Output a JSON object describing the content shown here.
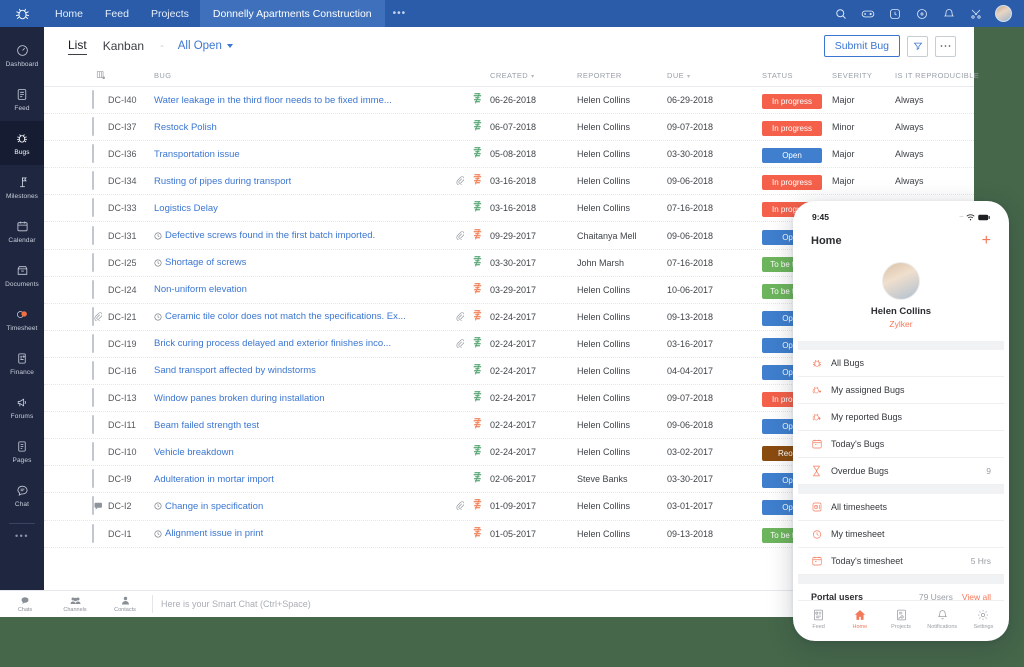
{
  "topbar": {
    "logo_icon": "bug-logo-icon",
    "nav": [
      {
        "label": "Home",
        "active": false
      },
      {
        "label": "Feed",
        "active": false
      },
      {
        "label": "Projects",
        "active": false
      },
      {
        "label": "Donnelly Apartments Construction",
        "active": true
      }
    ],
    "more_dots": "•••",
    "icons": [
      "search-icon",
      "game-controller-icon",
      "clock-icon",
      "plus-circle-icon",
      "bell-icon",
      "tools-icon"
    ],
    "avatar": "user-avatar"
  },
  "sidebar": {
    "items": [
      {
        "label": "Dashboard",
        "icon": "dashboard-icon",
        "active": false
      },
      {
        "label": "Feed",
        "icon": "feed-icon",
        "active": false
      },
      {
        "label": "Bugs",
        "icon": "bug-icon",
        "active": true
      },
      {
        "label": "Milestones",
        "icon": "milestone-flag-icon",
        "active": false
      },
      {
        "label": "Calendar",
        "icon": "calendar-icon",
        "active": false
      },
      {
        "label": "Documents",
        "icon": "documents-icon",
        "active": false
      },
      {
        "label": "Timesheet",
        "icon": "timesheet-icon",
        "active": false
      },
      {
        "label": "Finance",
        "icon": "finance-icon",
        "active": false
      },
      {
        "label": "Forums",
        "icon": "megaphone-icon",
        "active": false
      },
      {
        "label": "Pages",
        "icon": "pages-icon",
        "active": false
      },
      {
        "label": "Chat",
        "icon": "chat-icon",
        "active": false
      }
    ],
    "more_dots": "•••"
  },
  "toolbar": {
    "tab_list": "List",
    "tab_kanban": "Kanban",
    "separator": "-",
    "filter_label": "All Open",
    "submit_label": "Submit Bug",
    "filter_icon": "funnel-icon",
    "more_icon": "ellipsis-icon"
  },
  "table": {
    "headers": {
      "bug": "BUG",
      "created": "CREATED",
      "reporter": "REPORTER",
      "due": "DUE",
      "status": "STATUS",
      "severity": "SEVERITY",
      "reproducible": "IS IT REPRODUCIBLE"
    },
    "status_colors": {
      "In progress": "#f4604a",
      "Open": "#3f7fce",
      "To be tested": "#6db55d",
      "Reopen": "#8a4b0f"
    },
    "rows": [
      {
        "lead": "",
        "id": "DC-I40",
        "clock": false,
        "title": "Water leakage in the third floor needs to be fixed imme...",
        "attach": false,
        "priority": "green",
        "created": "06-26-2018",
        "reporter": "Helen Collins",
        "due": "06-29-2018",
        "status": "In progress",
        "severity": "Major",
        "reproducible": "Always"
      },
      {
        "lead": "",
        "id": "DC-I37",
        "clock": false,
        "title": "Restock Polish",
        "attach": false,
        "priority": "green",
        "created": "06-07-2018",
        "reporter": "Helen Collins",
        "due": "09-07-2018",
        "status": "In progress",
        "severity": "Minor",
        "reproducible": "Always"
      },
      {
        "lead": "",
        "id": "DC-I36",
        "clock": false,
        "title": "Transportation issue",
        "attach": false,
        "priority": "green",
        "created": "05-08-2018",
        "reporter": "Helen Collins",
        "due": "03-30-2018",
        "status": "Open",
        "severity": "Major",
        "reproducible": "Always"
      },
      {
        "lead": "",
        "id": "DC-I34",
        "clock": false,
        "title": "Rusting of pipes during transport",
        "attach": true,
        "priority": "orange",
        "created": "03-16-2018",
        "reporter": "Helen Collins",
        "due": "09-06-2018",
        "status": "In progress",
        "severity": "Major",
        "reproducible": "Always"
      },
      {
        "lead": "",
        "id": "DC-I33",
        "clock": false,
        "title": "Logistics Delay",
        "attach": false,
        "priority": "green",
        "created": "03-16-2018",
        "reporter": "Helen Collins",
        "due": "07-16-2018",
        "status": "In progress",
        "severity": "",
        "reproducible": ""
      },
      {
        "lead": "",
        "id": "DC-I31",
        "clock": true,
        "title": "Defective screws found in the first batch imported.",
        "attach": true,
        "priority": "orange",
        "created": "09-29-2017",
        "reporter": "Chaitanya Mell",
        "due": "09-06-2018",
        "status": "Open",
        "severity": "",
        "reproducible": ""
      },
      {
        "lead": "",
        "id": "DC-I25",
        "clock": true,
        "title": "Shortage of screws",
        "attach": false,
        "priority": "green",
        "created": "03-30-2017",
        "reporter": "John Marsh",
        "due": "07-16-2018",
        "status": "To be tested",
        "severity": "",
        "reproducible": ""
      },
      {
        "lead": "",
        "id": "DC-I24",
        "clock": false,
        "title": "Non-uniform elevation",
        "attach": false,
        "priority": "orange",
        "created": "03-29-2017",
        "reporter": "Helen Collins",
        "due": "10-06-2017",
        "status": "To be tested",
        "severity": "",
        "reproducible": ""
      },
      {
        "lead": "attach",
        "id": "DC-I21",
        "clock": true,
        "title": "Ceramic tile color does not match the specifications. Ex...",
        "attach": true,
        "priority": "orange",
        "created": "02-24-2017",
        "reporter": "Helen Collins",
        "due": "09-13-2018",
        "status": "Open",
        "severity": "",
        "reproducible": ""
      },
      {
        "lead": "",
        "id": "DC-I19",
        "clock": false,
        "title": "Brick curing process delayed and exterior finishes inco...",
        "attach": true,
        "priority": "green",
        "created": "02-24-2017",
        "reporter": "Helen Collins",
        "due": "03-16-2017",
        "status": "Open",
        "severity": "",
        "reproducible": ""
      },
      {
        "lead": "",
        "id": "DC-I16",
        "clock": false,
        "title": "Sand transport affected by windstorms",
        "attach": false,
        "priority": "green",
        "created": "02-24-2017",
        "reporter": "Helen Collins",
        "due": "04-04-2017",
        "status": "Open",
        "severity": "",
        "reproducible": ""
      },
      {
        "lead": "",
        "id": "DC-I13",
        "clock": false,
        "title": "Window panes broken during installation",
        "attach": false,
        "priority": "green",
        "created": "02-24-2017",
        "reporter": "Helen Collins",
        "due": "09-07-2018",
        "status": "In progress",
        "severity": "",
        "reproducible": ""
      },
      {
        "lead": "",
        "id": "DC-I11",
        "clock": false,
        "title": "Beam failed strength test",
        "attach": false,
        "priority": "orange",
        "created": "02-24-2017",
        "reporter": "Helen Collins",
        "due": "09-06-2018",
        "status": "Open",
        "severity": "",
        "reproducible": ""
      },
      {
        "lead": "",
        "id": "DC-I10",
        "clock": false,
        "title": "Vehicle breakdown",
        "attach": false,
        "priority": "green",
        "created": "02-24-2017",
        "reporter": "Helen Collins",
        "due": "03-02-2017",
        "status": "Reopen",
        "severity": "",
        "reproducible": ""
      },
      {
        "lead": "",
        "id": "DC-I9",
        "clock": false,
        "title": "Adulteration in mortar import",
        "attach": false,
        "priority": "green",
        "created": "02-06-2017",
        "reporter": "Steve Banks",
        "due": "03-30-2017",
        "status": "Open",
        "severity": "",
        "reproducible": ""
      },
      {
        "lead": "comment",
        "id": "DC-I2",
        "clock": true,
        "title": "Change in specification",
        "attach": true,
        "priority": "orange",
        "created": "01-09-2017",
        "reporter": "Helen Collins",
        "due": "03-01-2017",
        "status": "Open",
        "severity": "",
        "reproducible": ""
      },
      {
        "lead": "",
        "id": "DC-I1",
        "clock": true,
        "title": "Alignment issue in print",
        "attach": false,
        "priority": "orange",
        "created": "01-05-2017",
        "reporter": "Helen Collins",
        "due": "09-13-2018",
        "status": "To be tested",
        "severity": "",
        "reproducible": ""
      }
    ]
  },
  "chatbar": {
    "items": [
      {
        "label": "Chats",
        "icon": "chat-bubble-icon"
      },
      {
        "label": "Channels",
        "icon": "channels-icon"
      },
      {
        "label": "Contacts",
        "icon": "contacts-icon"
      }
    ],
    "placeholder": "Here is your Smart Chat (Ctrl+Space)"
  },
  "phone": {
    "status_time": "9:45",
    "wifi_icon": "wifi-icon",
    "battery_icon": "battery-icon",
    "header_title": "Home",
    "add_icon": "plus-icon",
    "profile": {
      "name": "Helen Collins",
      "org": "Zylker",
      "avatar": "user-avatar"
    },
    "menu_group_1": [
      {
        "label": "All Bugs",
        "icon": "bug-icon",
        "value": ""
      },
      {
        "label": "My assigned Bugs",
        "icon": "bug-assigned-icon",
        "value": ""
      },
      {
        "label": "My reported Bugs",
        "icon": "bug-reported-icon",
        "value": ""
      },
      {
        "label": "Today's Bugs",
        "icon": "calendar-icon",
        "value": ""
      },
      {
        "label": "Overdue Bugs",
        "icon": "hourglass-icon",
        "value": "9"
      }
    ],
    "menu_group_2": [
      {
        "label": "All timesheets",
        "icon": "timesheet-icon",
        "value": ""
      },
      {
        "label": "My timesheet",
        "icon": "stopwatch-icon",
        "value": ""
      },
      {
        "label": "Today's timesheet",
        "icon": "calendar-icon",
        "value": "5 Hrs"
      }
    ],
    "portal": {
      "title": "Portal users",
      "count": "79 Users",
      "view_all": "View all"
    },
    "tabs": [
      {
        "label": "Feed",
        "icon": "feed-icon",
        "active": false
      },
      {
        "label": "Home",
        "icon": "home-icon",
        "active": true
      },
      {
        "label": "Projects",
        "icon": "projects-icon",
        "active": false
      },
      {
        "label": "Notifications",
        "icon": "bell-icon",
        "active": false
      },
      {
        "label": "Settings",
        "icon": "gear-icon",
        "active": false
      }
    ]
  },
  "colors": {
    "topbar": "#2a5caa",
    "sidebar": "#1f2740",
    "accent_blue": "#3b76d1",
    "accent_orange": "#f4795b",
    "page_bg": "#46674a"
  }
}
